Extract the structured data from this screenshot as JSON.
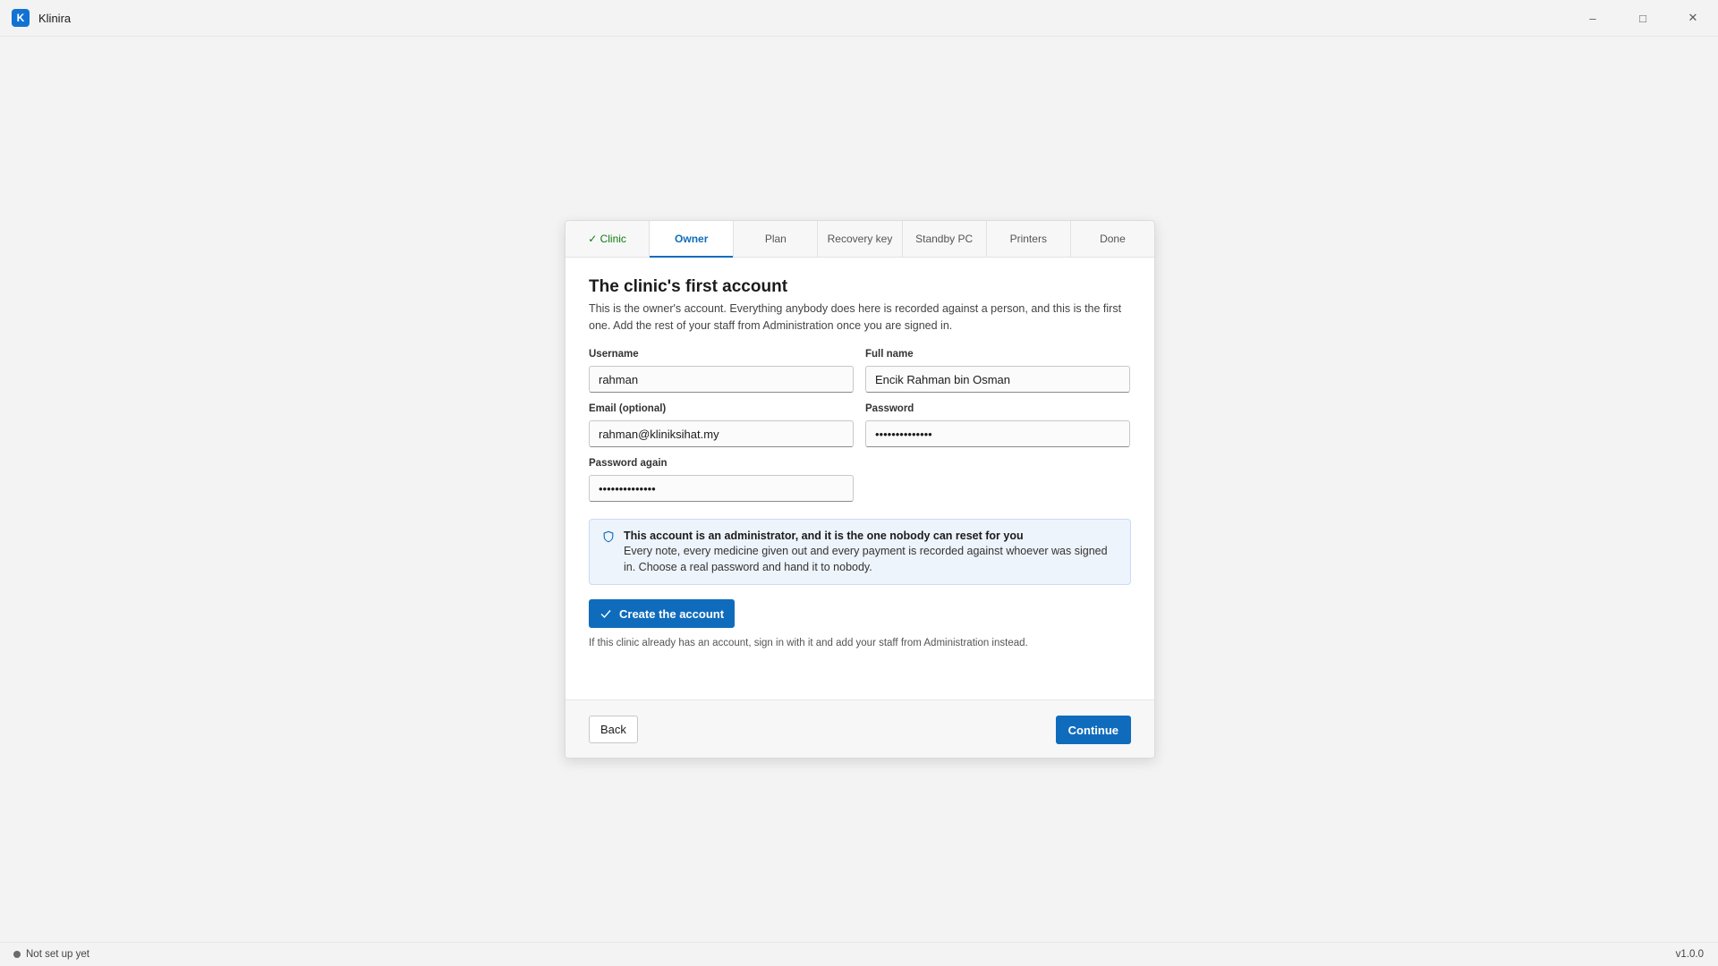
{
  "window": {
    "logo_letter": "K",
    "title": "Klinira",
    "minimize": "–",
    "maximize": "□",
    "close": "✕"
  },
  "steps": [
    {
      "label": "✓ Clinic",
      "state": "done"
    },
    {
      "label": "Owner",
      "state": "active"
    },
    {
      "label": "Plan",
      "state": "pending"
    },
    {
      "label": "Recovery key",
      "state": "pending"
    },
    {
      "label": "Standby PC",
      "state": "pending"
    },
    {
      "label": "Printers",
      "state": "pending"
    },
    {
      "label": "Done",
      "state": "pending"
    }
  ],
  "page": {
    "title": "The clinic's first account",
    "intro": "This is the owner's account. Everything anybody does here is recorded against a person, and this is the first one. Add the rest of your staff from Administration once you are signed in."
  },
  "form": {
    "username": {
      "label": "Username",
      "value": "rahman"
    },
    "full_name": {
      "label": "Full name",
      "value": "Encik Rahman bin Osman"
    },
    "email": {
      "label": "Email (optional)",
      "value": "rahman@kliniksihat.my"
    },
    "password": {
      "label": "Password",
      "value": "••••••••••••••"
    },
    "password_again": {
      "label": "Password again",
      "value": "••••••••••••••"
    }
  },
  "notice": {
    "icon": "shield-icon",
    "title": "This account is an administrator, and it is the one nobody can reset for you",
    "body": "Every note, every medicine given out and every payment is recorded against whoever was signed in. Choose a real password and hand it to nobody."
  },
  "actions": {
    "create_label": "Create the account",
    "hint": "If this clinic already has an account, sign in with it and add your staff from Administration instead.",
    "back_label": "Back",
    "continue_label": "Continue"
  },
  "status": {
    "text": "Not set up yet",
    "version": "v1.0.0"
  },
  "colors": {
    "accent": "#0f6cbd",
    "done_step": "#107c10",
    "notice_bg": "#eef4fc"
  }
}
